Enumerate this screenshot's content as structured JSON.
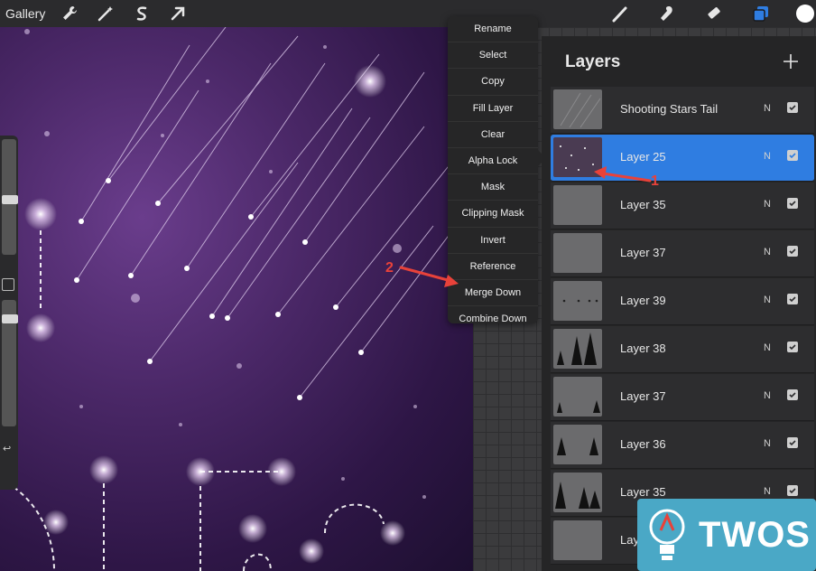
{
  "toolbar": {
    "gallery_label": "Gallery",
    "left_icons": [
      "wrench-icon",
      "magic-wand-icon",
      "selection-icon",
      "transform-arrow-icon"
    ],
    "right_icons": [
      "brush-icon",
      "smudge-icon",
      "eraser-icon",
      "layers-icon"
    ],
    "active_color": "#ffffff"
  },
  "menu": {
    "items": [
      "Rename",
      "Select",
      "Copy",
      "Fill Layer",
      "Clear",
      "Alpha Lock",
      "Mask",
      "Clipping Mask",
      "Invert",
      "Reference",
      "Merge Down",
      "Combine Down"
    ]
  },
  "layers_panel": {
    "title": "Layers",
    "layers": [
      {
        "name": "Shooting Stars Tail",
        "blend": "N",
        "visible": true,
        "active": false
      },
      {
        "name": "Layer 25",
        "blend": "N",
        "visible": true,
        "active": true
      },
      {
        "name": "Layer 35",
        "blend": "N",
        "visible": true,
        "active": false
      },
      {
        "name": "Layer 37",
        "blend": "N",
        "visible": true,
        "active": false
      },
      {
        "name": "Layer 39",
        "blend": "N",
        "visible": true,
        "active": false
      },
      {
        "name": "Layer 38",
        "blend": "N",
        "visible": true,
        "active": false
      },
      {
        "name": "Layer 37",
        "blend": "N",
        "visible": true,
        "active": false
      },
      {
        "name": "Layer 36",
        "blend": "N",
        "visible": true,
        "active": false
      },
      {
        "name": "Layer 35",
        "blend": "N",
        "visible": true,
        "active": false
      },
      {
        "name": "Lay",
        "blend": "",
        "visible": false,
        "active": false
      }
    ]
  },
  "annotations": {
    "label_1": "1",
    "label_2": "2",
    "color": "#e8423a"
  },
  "watermark": {
    "text": "TWOS"
  },
  "colors": {
    "accent": "#2f7de1",
    "panel": "#252526"
  }
}
